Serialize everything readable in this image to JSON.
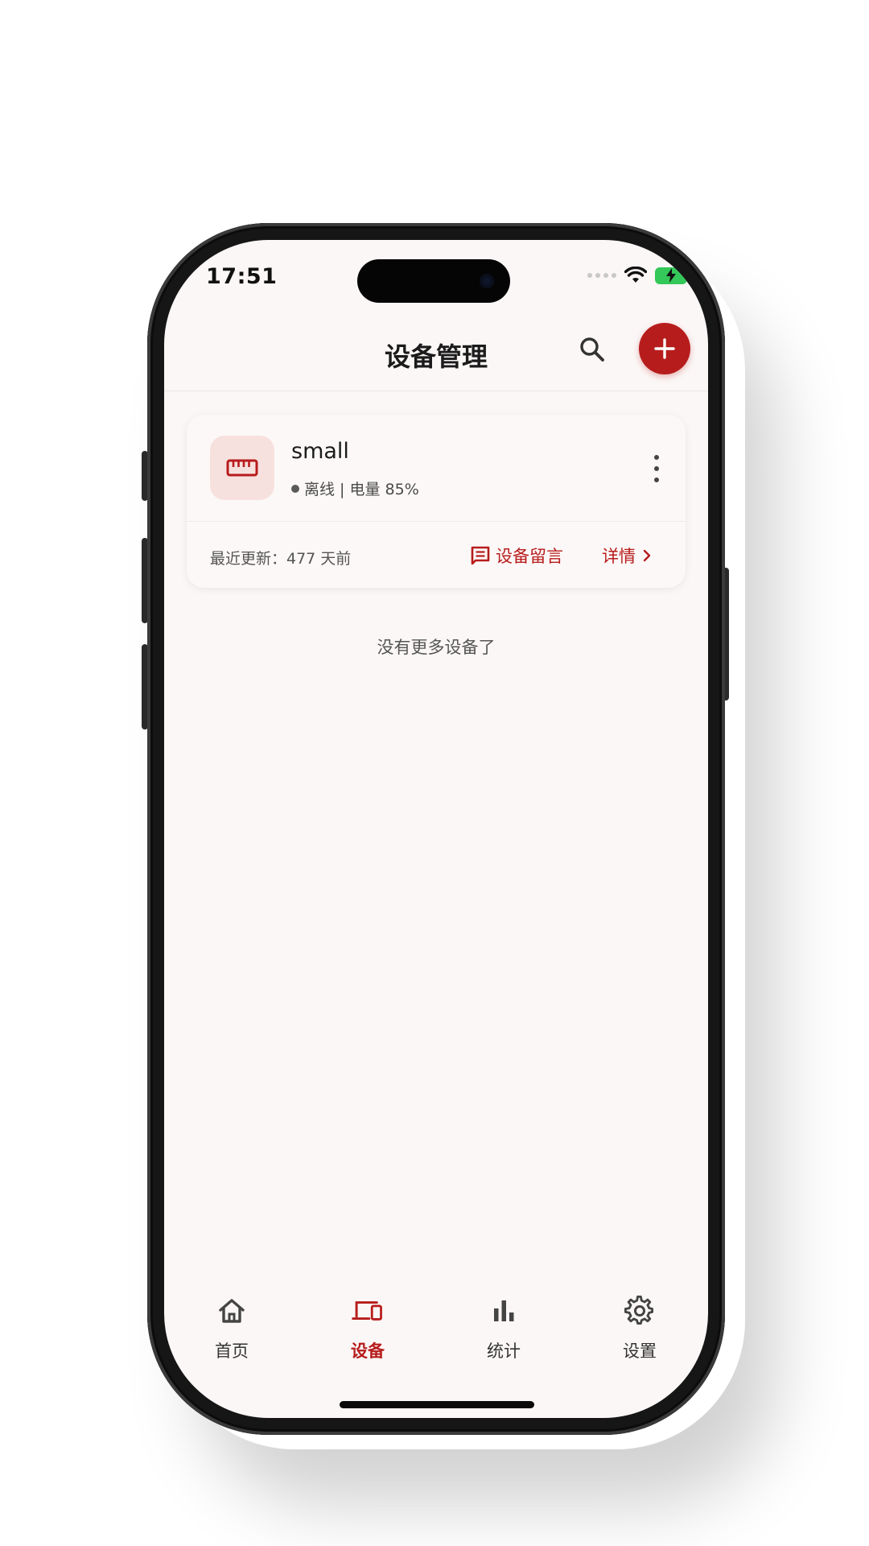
{
  "status_bar": {
    "time": "17:51"
  },
  "header": {
    "title": "设备管理"
  },
  "device_card": {
    "name": "small",
    "status": "离线 | 电量 85%",
    "last_update": "最近更新：477 天前",
    "message_label": "设备留言",
    "detail_label": "详情"
  },
  "list_footer": "没有更多设备了",
  "tabs": [
    {
      "label": "首页",
      "icon": "home-icon"
    },
    {
      "label": "设备",
      "icon": "devices-icon"
    },
    {
      "label": "统计",
      "icon": "bar-chart-icon"
    },
    {
      "label": "设置",
      "icon": "gear-icon"
    }
  ],
  "colors": {
    "accent": "#b71c1c",
    "background": "#fbf7f6",
    "icon_bg": "#f7e1df"
  }
}
